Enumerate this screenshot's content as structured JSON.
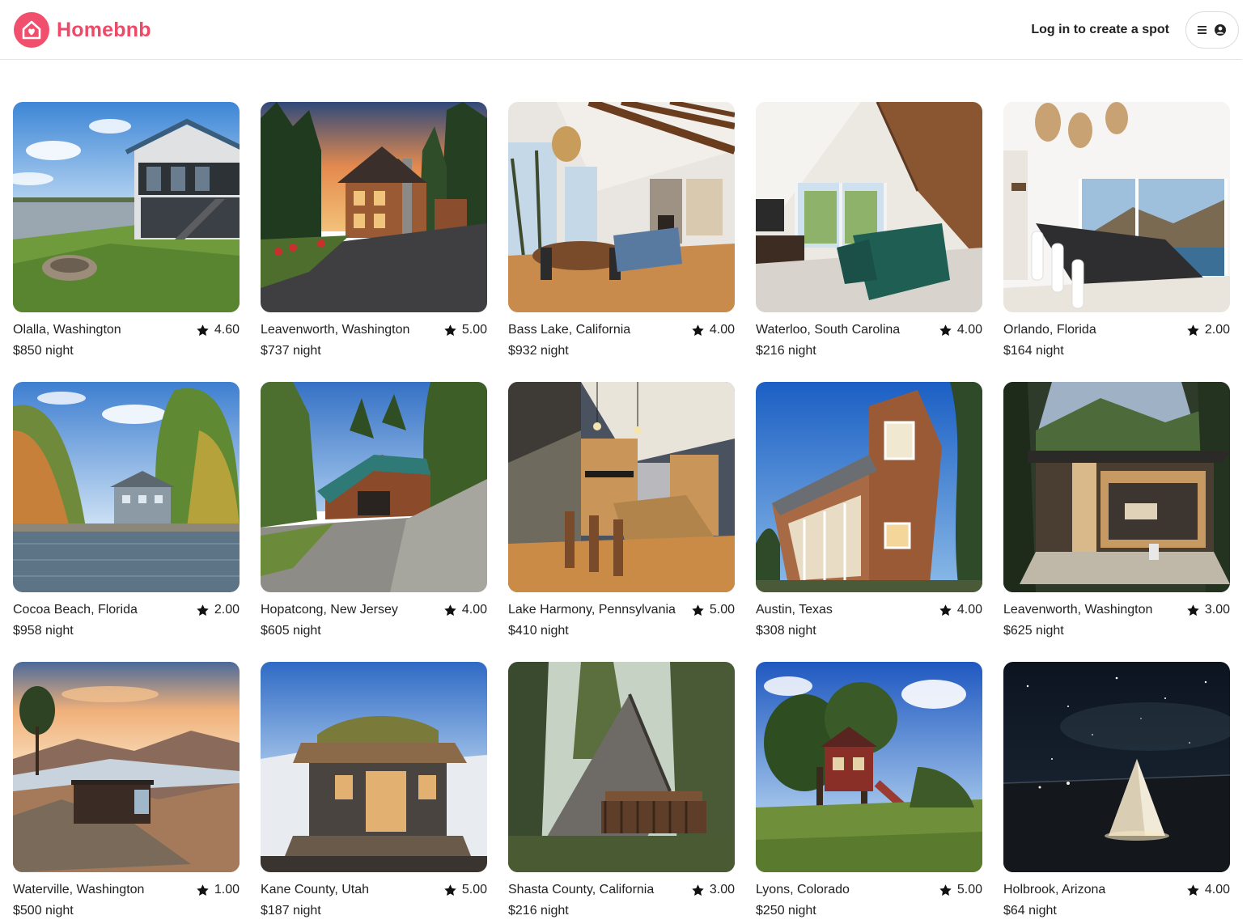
{
  "app": {
    "brand": "Homebnb",
    "login_link": "Log in to create a spot",
    "brand_color": "#ec4a67"
  },
  "listings": [
    {
      "location": "Olalla, Washington",
      "rating": "4.60",
      "price": "$850 night",
      "scene": "lake-house"
    },
    {
      "location": "Leavenworth, Washington",
      "rating": "5.00",
      "price": "$737 night",
      "scene": "log-lodge"
    },
    {
      "location": "Bass Lake, California",
      "rating": "4.00",
      "price": "$932 night",
      "scene": "dining-room"
    },
    {
      "location": "Waterloo, South Carolina",
      "rating": "4.00",
      "price": "$216 night",
      "scene": "a-frame-living-room"
    },
    {
      "location": "Orlando, Florida",
      "rating": "2.00",
      "price": "$164 night",
      "scene": "bright-dining-room"
    },
    {
      "location": "Cocoa Beach, Florida",
      "rating": "2.00",
      "price": "$958 night",
      "scene": "lakeside-autumn-house"
    },
    {
      "location": "Hopatcong, New Jersey",
      "rating": "4.00",
      "price": "$605 night",
      "scene": "green-roof-house"
    },
    {
      "location": "Lake Harmony, Pennsylvania",
      "rating": "5.00",
      "price": "$410 night",
      "scene": "wood-kitchen"
    },
    {
      "location": "Austin, Texas",
      "rating": "4.00",
      "price": "$308 night",
      "scene": "shingle-house"
    },
    {
      "location": "Leavenworth, Washington",
      "rating": "3.00",
      "price": "$625 night",
      "scene": "modern-forest-cabin"
    },
    {
      "location": "Waterville, Washington",
      "rating": "1.00",
      "price": "$500 night",
      "scene": "mountain-cabin-sunset"
    },
    {
      "location": "Kane County, Utah",
      "rating": "5.00",
      "price": "$187 night",
      "scene": "sod-roof-cabin"
    },
    {
      "location": "Shasta County, California",
      "rating": "3.00",
      "price": "$216 night",
      "scene": "a-frame-treehouse"
    },
    {
      "location": "Lyons, Colorado",
      "rating": "5.00",
      "price": "$250 night",
      "scene": "red-treehouse"
    },
    {
      "location": "Holbrook, Arizona",
      "rating": "4.00",
      "price": "$64 night",
      "scene": "night-tent"
    }
  ]
}
